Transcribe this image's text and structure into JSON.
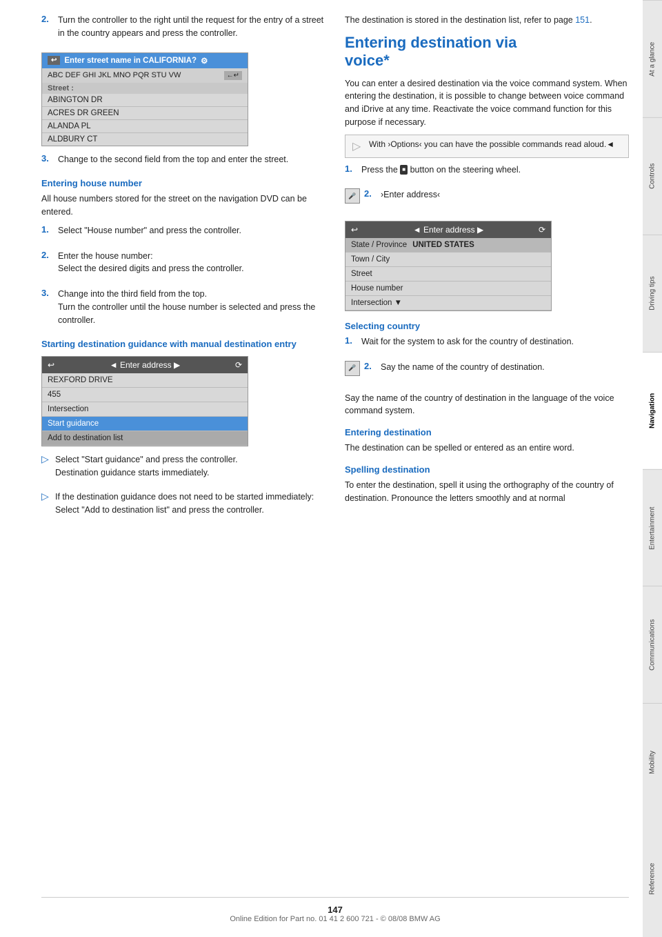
{
  "page": {
    "number": "147",
    "footer_text": "Online Edition for Part no. 01 41 2 600 721 - © 08/08 BMW AG"
  },
  "tabs": [
    {
      "label": "At a glance",
      "active": false
    },
    {
      "label": "Controls",
      "active": false
    },
    {
      "label": "Driving tips",
      "active": false
    },
    {
      "label": "Navigation",
      "active": true
    },
    {
      "label": "Entertainment",
      "active": false
    },
    {
      "label": "Communications",
      "active": false
    },
    {
      "label": "Mobility",
      "active": false
    },
    {
      "label": "Reference",
      "active": false
    }
  ],
  "left_col": {
    "step2": {
      "num": "2.",
      "text": "Turn the controller to the right until the request for the entry of a street in the country appears and press the controller."
    },
    "ui_street_box": {
      "header": "Enter street name in CALIFORNIA?",
      "keyboard": "ABC DEF GHI JKL MNO PQR STU VW",
      "enter_symbol": "←↵",
      "label": "Street :",
      "items": [
        "ABINGTON DR",
        "ACRES DR GREEN",
        "ALANDA PL",
        "ALDBURY CT"
      ]
    },
    "step3": {
      "num": "3.",
      "text": "Change to the second field from the top and enter the street."
    },
    "entering_house_number": {
      "heading": "Entering house number",
      "para1": "All house numbers stored for the street on the navigation DVD can be entered.",
      "step1": {
        "num": "1.",
        "text": "Select \"House number\" and press the controller."
      },
      "step2": {
        "num": "2.",
        "text": "Enter the house number:\nSelect the desired digits and press the controller."
      },
      "step3": {
        "num": "3.",
        "text": "Change into the third field from the top.\nTurn the controller until the house number is selected and press the controller."
      }
    },
    "starting_dest_guidance": {
      "heading": "Starting destination guidance with manual destination entry",
      "ui_addr_box": {
        "back_arrow": "↩",
        "refresh_icon": "⟳",
        "title": "◄ Enter address ▶",
        "items": [
          {
            "label": "REXFORD DRIVE",
            "style": "normal"
          },
          {
            "label": "455",
            "style": "normal"
          },
          {
            "label": "Intersection",
            "style": "normal"
          },
          {
            "label": "Start guidance",
            "style": "highlighted"
          },
          {
            "label": "Add to destination list",
            "style": "dark"
          }
        ]
      },
      "bullet1": {
        "arrow": "▷",
        "text1": "Select \"Start guidance\" and press the controller.",
        "text2": "Destination guidance starts immediately."
      },
      "bullet2": {
        "arrow": "▷",
        "text1": "If the destination guidance does not need to be started immediately:",
        "text2": "Select \"Add to destination list\" and press the controller."
      }
    }
  },
  "right_col": {
    "dest_stored_para": "The destination is stored in the destination list, refer to page ",
    "dest_stored_link": "151",
    "dest_stored_end": ".",
    "main_heading": "Entering destination via voice*",
    "intro_para": "You can enter a desired destination via the voice command system. When entering the destination, it is possible to change between voice command and iDrive at any time. Reactivate the voice command function for this purpose if necessary.",
    "info_box": {
      "triangle": "▷",
      "text": "With ›Options‹ you can have the possible commands read aloud.◄"
    },
    "step1": {
      "num": "1.",
      "text1": "Press the ",
      "icon": "■",
      "text2": " button on the steering wheel."
    },
    "step2_icon": "🎤",
    "step2": {
      "num": "2.",
      "text": "›Enter address‹"
    },
    "ui_voice_box": {
      "back_arrow": "↩",
      "refresh_icon": "⟳",
      "title": "◄ Enter address ▶",
      "state_row": {
        "label": "State / Province",
        "value": "UNITED STATES"
      },
      "items": [
        "Town / City",
        "Street",
        "House number",
        "Intersection"
      ]
    },
    "selecting_country": {
      "heading": "Selecting country",
      "step1": {
        "num": "1.",
        "text": "Wait for the system to ask for the country of destination."
      },
      "step2_icon": "🎤",
      "step2": {
        "num": "2.",
        "text": "Say the name of the country of destination."
      },
      "para1": "Say the name of the country of destination in the language of the voice command system."
    },
    "entering_destination": {
      "heading": "Entering destination",
      "para1": "The destination can be spelled or entered as an entire word."
    },
    "spelling_destination": {
      "heading": "Spelling destination",
      "para1": "To enter the destination, spell it using the orthography of the country of destination. Pronounce the letters smoothly and at normal"
    }
  }
}
